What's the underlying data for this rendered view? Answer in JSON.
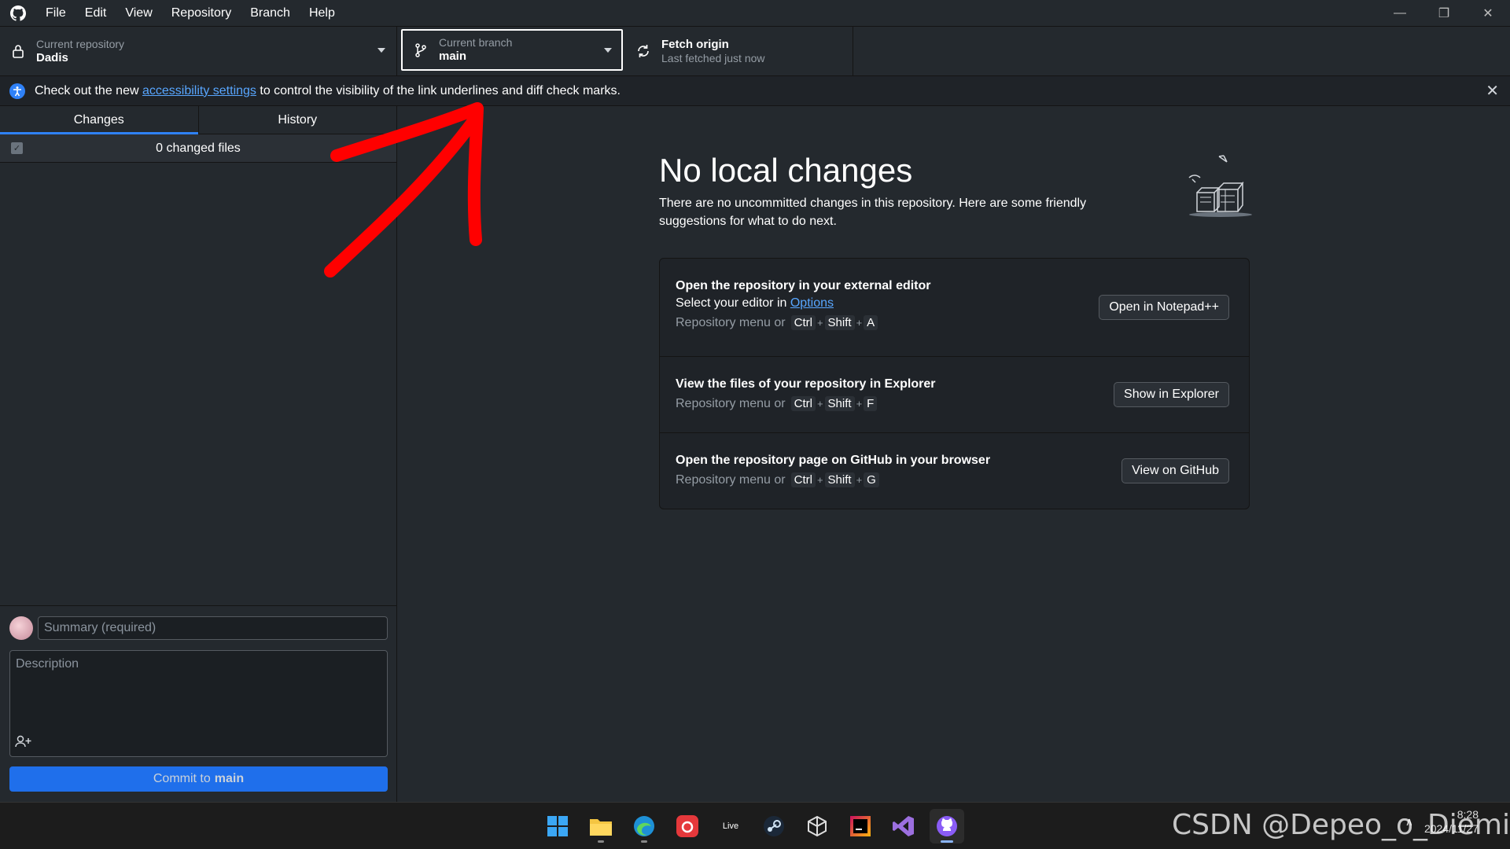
{
  "titlebar": {
    "menu": [
      "File",
      "Edit",
      "View",
      "Repository",
      "Branch",
      "Help"
    ]
  },
  "toolbar": {
    "repo_label": "Current repository",
    "repo_value": "Dadis",
    "branch_label": "Current branch",
    "branch_value": "main",
    "fetch_title": "Fetch origin",
    "fetch_sub": "Last fetched just now"
  },
  "banner": {
    "text_before": "Check out the new ",
    "link": "accessibility settings",
    "text_after": " to control the visibility of the link underlines and diff check marks."
  },
  "sidebar": {
    "tabs": [
      "Changes",
      "History"
    ],
    "changed_files": "0 changed files",
    "summary_placeholder": "Summary (required)",
    "description_placeholder": "Description",
    "commit_prefix": "Commit to",
    "commit_branch": "main"
  },
  "main": {
    "title": "No local changes",
    "subtitle": "There are no uncommitted changes in this repository. Here are some friendly suggestions for what to do next.",
    "cards": [
      {
        "title": "Open the repository in your external editor",
        "sub_prefix": "Select your editor in ",
        "sub_link": "Options",
        "shortcut_prefix": "Repository menu or",
        "keys": [
          "Ctrl",
          "Shift",
          "A"
        ],
        "button": "Open in Notepad++"
      },
      {
        "title": "View the files of your repository in Explorer",
        "shortcut_prefix": "Repository menu or",
        "keys": [
          "Ctrl",
          "Shift",
          "F"
        ],
        "button": "Show in Explorer"
      },
      {
        "title": "Open the repository page on GitHub in your browser",
        "shortcut_prefix": "Repository menu or",
        "keys": [
          "Ctrl",
          "Shift",
          "G"
        ],
        "button": "View on GitHub"
      }
    ]
  },
  "taskbar": {
    "apps": [
      "windows-start",
      "file-explorer",
      "edge",
      "netease-music",
      "live",
      "steam",
      "unity",
      "rider",
      "visual-studio",
      "github-desktop"
    ],
    "live_label": "Live",
    "time": "8:28",
    "date": "2024/11/27"
  },
  "watermark": "CSDN @Depeo_o_Diemi",
  "colors": {
    "accent": "#1f6feb",
    "link": "#58a6ff",
    "arrow": "#ff0000",
    "background": "#24292e"
  }
}
